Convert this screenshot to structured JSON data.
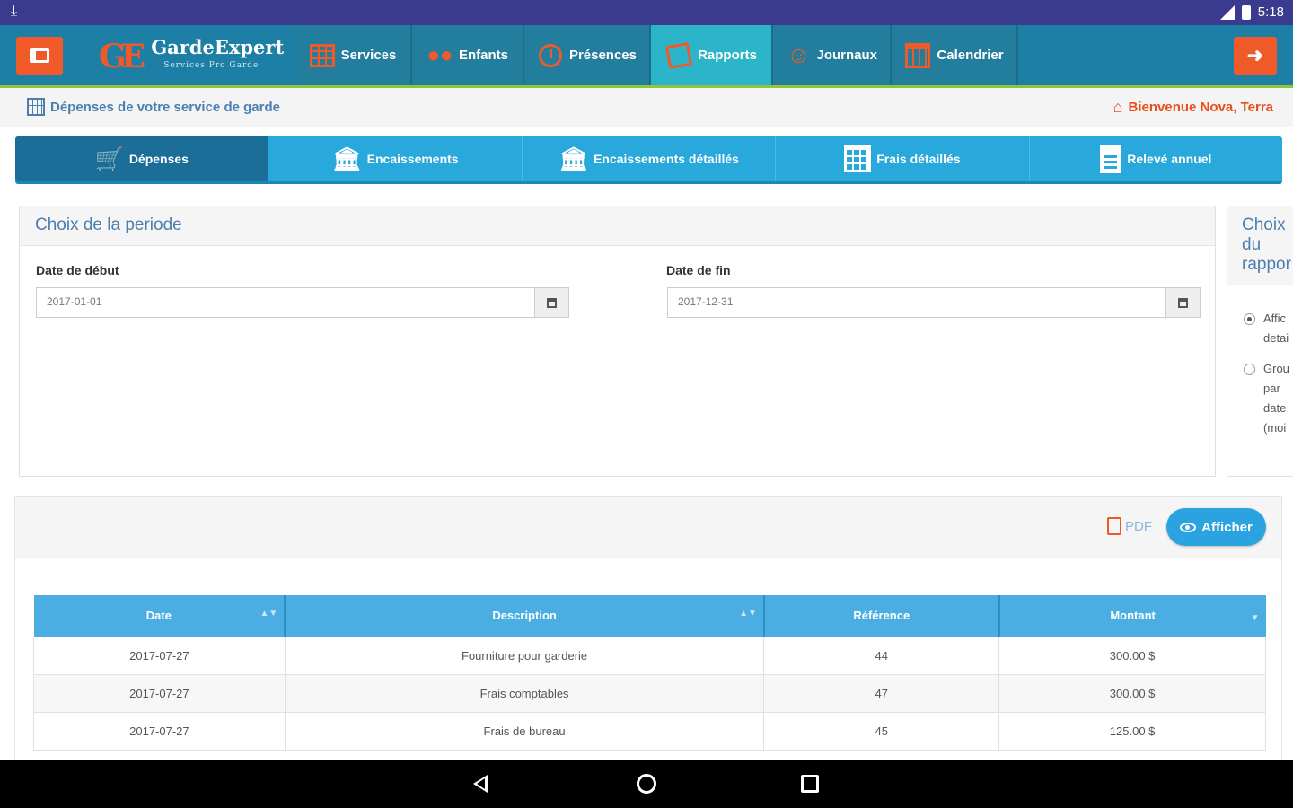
{
  "status_bar": {
    "time": "5:18",
    "download_icon": "download-icon"
  },
  "app": {
    "logo_mark": "GE",
    "logo_name": "GardeExpert",
    "logo_tagline": "Services Pro Garde"
  },
  "nav": {
    "tabs": [
      {
        "label": "Services",
        "icon": "grid-icon"
      },
      {
        "label": "Enfants",
        "icon": "people-icon"
      },
      {
        "label": "Présences",
        "icon": "clock-icon"
      },
      {
        "label": "Rapports",
        "icon": "documents-icon",
        "active": true
      },
      {
        "label": "Journaux",
        "icon": "smile-icon"
      },
      {
        "label": "Calendrier",
        "icon": "calendar-icon"
      }
    ]
  },
  "breadcrumb": {
    "title": "Dépenses de votre service de garde"
  },
  "welcome": {
    "text": "Bienvenue Nova, Terra"
  },
  "report_tabs": [
    {
      "label": "Dépenses",
      "icon": "cart-icon",
      "active": true
    },
    {
      "label": "Encaissements",
      "icon": "bank-icon"
    },
    {
      "label": "Encaissements détaillés",
      "icon": "bank-icon"
    },
    {
      "label": "Frais détaillés",
      "icon": "table-icon"
    },
    {
      "label": "Relevé annuel",
      "icon": "document-icon"
    }
  ],
  "period": {
    "title": "Choix de la periode",
    "start_label": "Date de début",
    "start_value": "2017-01-01",
    "end_label": "Date de fin",
    "end_value": "2017-12-31"
  },
  "report_choice": {
    "title": "Choix du rappor",
    "options": [
      {
        "label": "Affic detai",
        "selected": true
      },
      {
        "label": "Grou par date (moi",
        "selected": false
      }
    ]
  },
  "actions": {
    "pdf_label": "PDF",
    "show_label": "Afficher"
  },
  "table": {
    "headers": [
      "Date",
      "Description",
      "Référence",
      "Montant"
    ],
    "rows": [
      [
        "2017-07-27",
        "Fourniture pour garderie",
        "44",
        "300.00 $"
      ],
      [
        "2017-07-27",
        "Frais comptables",
        "47",
        "300.00 $"
      ],
      [
        "2017-07-27",
        "Frais de bureau",
        "45",
        "125.00 $"
      ]
    ]
  },
  "colors": {
    "nav": "#1d7fa6",
    "accent": "#f05a28",
    "tab_blue": "#29a8dc",
    "active_tab": "#2cb5c9"
  }
}
